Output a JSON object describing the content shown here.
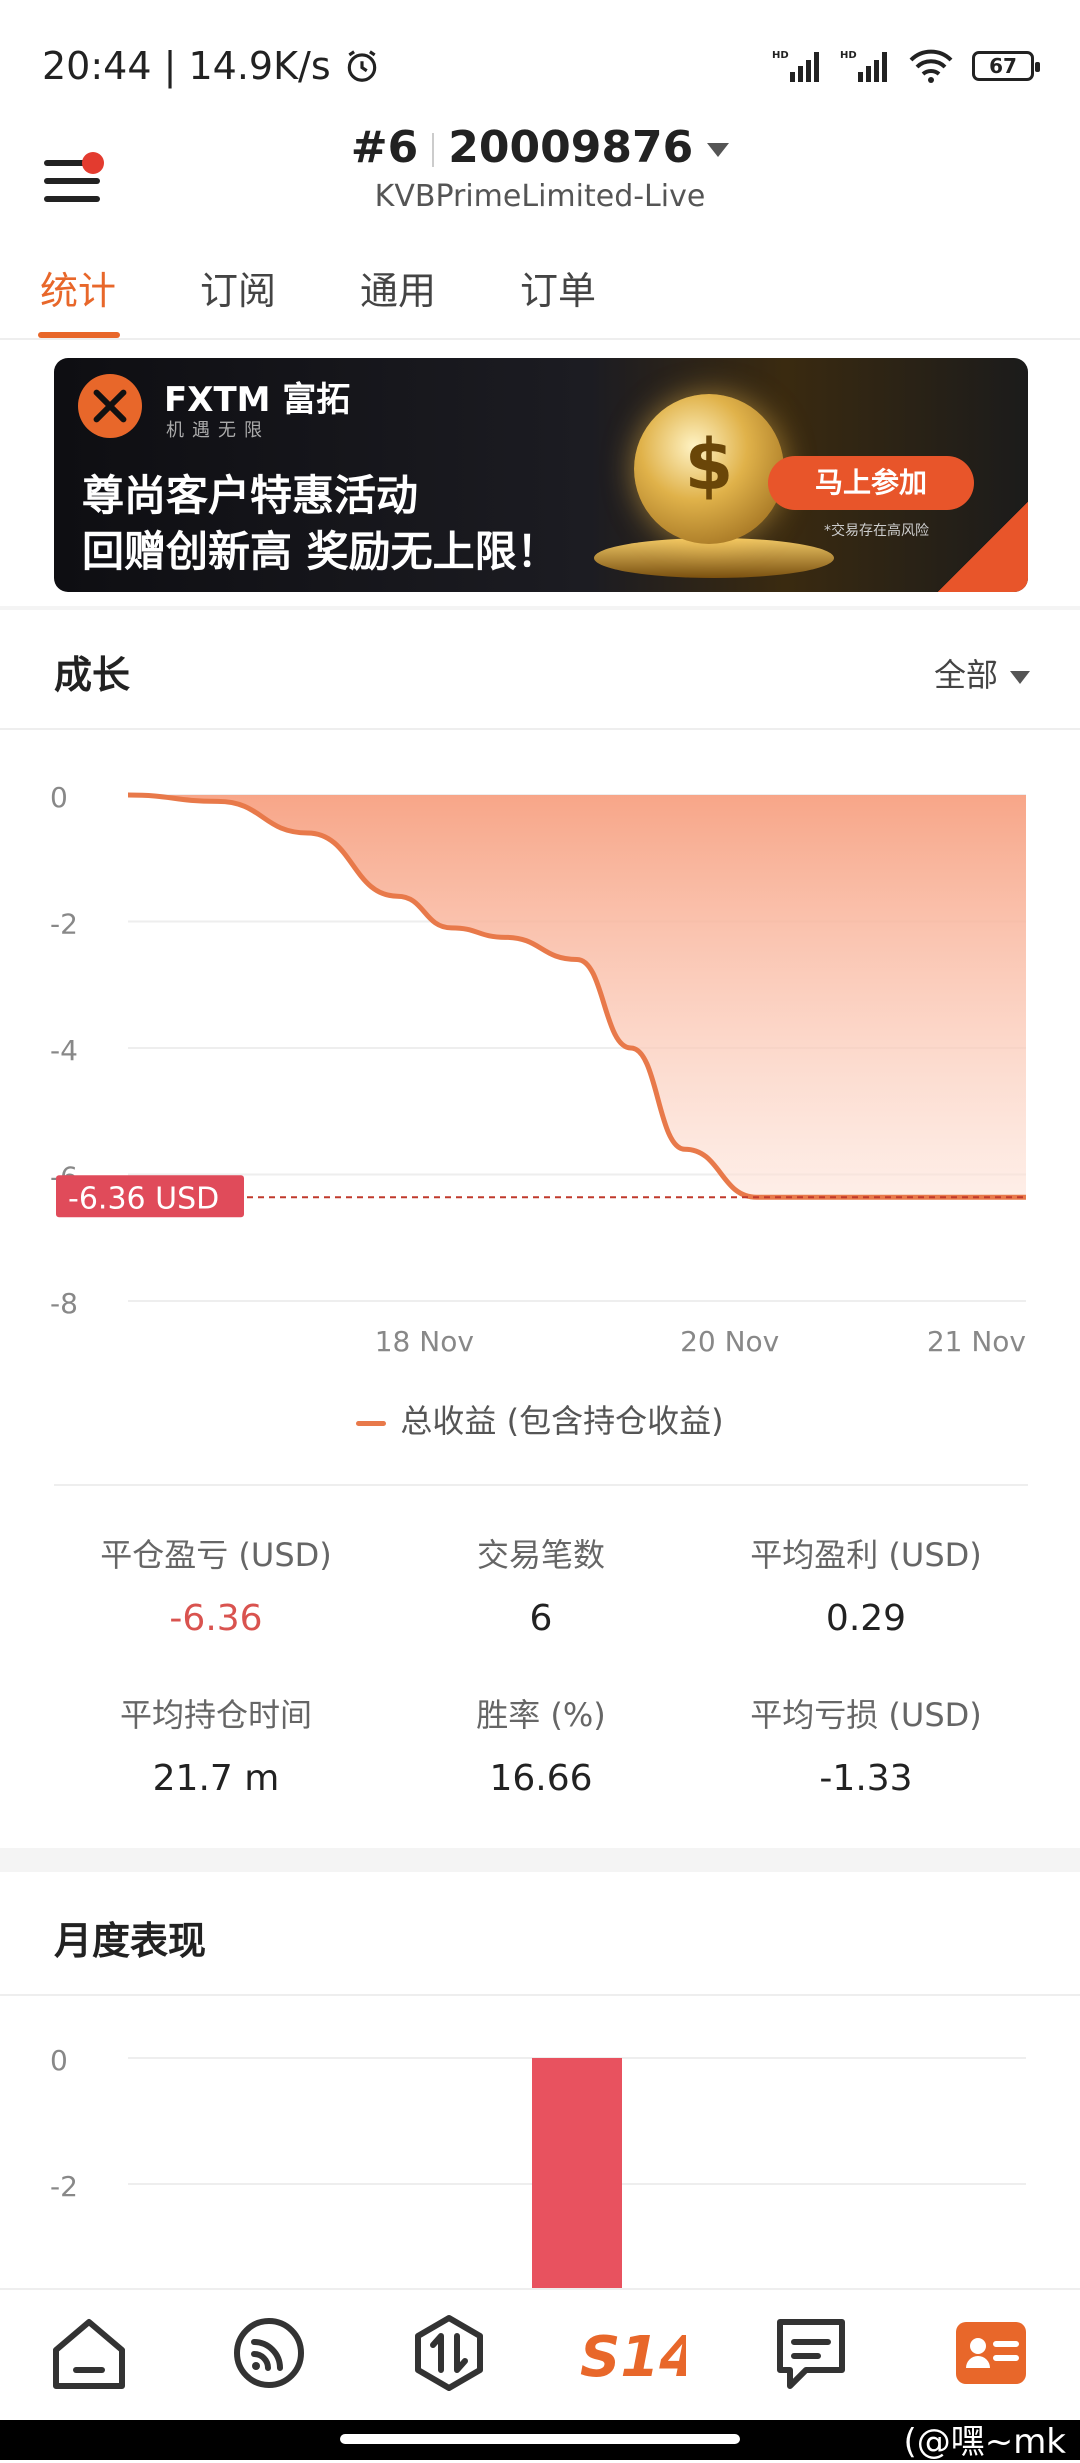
{
  "status_bar": {
    "time": "20:44",
    "network_speed": "14.9K/s",
    "battery": "67",
    "icons": [
      "alarm-icon",
      "signal-hd-icon",
      "signal-hd-icon",
      "wifi-6-icon",
      "battery-icon"
    ]
  },
  "header": {
    "account_number": "#6",
    "account_id": "20009876",
    "server": "KVBPrimeLimited-Live"
  },
  "tabs": [
    {
      "label": "统计",
      "active": true
    },
    {
      "label": "订阅"
    },
    {
      "label": "通用"
    },
    {
      "label": "订单"
    }
  ],
  "banner": {
    "brand": "FXTM 富拓",
    "slogan": "机遇无限",
    "headline1": "尊尚客户特惠活动",
    "headline2": "回赠创新高 奖励无上限！",
    "cta": "马上参加",
    "risk": "*交易存在高风险"
  },
  "growth": {
    "title": "成长",
    "filter": "全部",
    "legend": "总收益 (包含持仓收益)",
    "current_label": "-6.36 USD"
  },
  "stats": [
    {
      "label": "平仓盈亏 (USD)",
      "value": "-6.36",
      "negative": true
    },
    {
      "label": "交易笔数",
      "value": "6"
    },
    {
      "label": "平均盈利 (USD)",
      "value": "0.29"
    },
    {
      "label": "平均持仓时间",
      "value": "21.7 m"
    },
    {
      "label": "胜率 (%)",
      "value": "16.66"
    },
    {
      "label": "平均亏损 (USD)",
      "value": "-1.33"
    }
  ],
  "monthly": {
    "title": "月度表现"
  },
  "chart_data": [
    {
      "type": "area",
      "title": "成长",
      "series": [
        {
          "name": "总收益 (包含持仓收益)",
          "x": [
            0,
            0.1,
            0.2,
            0.3,
            0.36,
            0.42,
            0.5,
            0.56,
            0.62,
            0.7,
            1.0
          ],
          "values": [
            0,
            -0.1,
            -0.6,
            -1.6,
            -2.1,
            -2.25,
            -2.6,
            -4.0,
            -5.6,
            -6.36,
            -6.36
          ]
        }
      ],
      "x_tick_labels": [
        "18 Nov",
        "20 Nov",
        "21 Nov"
      ],
      "x_tick_positions": [
        0.33,
        0.67,
        1.0
      ],
      "yticks": [
        0,
        -2,
        -4,
        -6,
        -8
      ],
      "ylim": [
        -8,
        0
      ],
      "current_value": -6.36,
      "current_label": "-6.36 USD",
      "grid": true,
      "legend": "bottom"
    },
    {
      "type": "bar",
      "title": "月度表现",
      "yticks": [
        0,
        -2
      ],
      "categories": [
        ""
      ],
      "values": [
        -6.36
      ],
      "ylim": [
        -8,
        0
      ],
      "grid": true
    }
  ]
}
